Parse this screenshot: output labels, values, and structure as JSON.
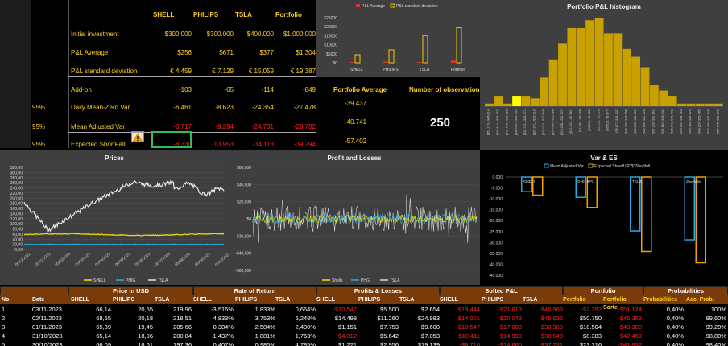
{
  "top_table": {
    "headers": [
      "SHELL",
      "PHILIPS",
      "TSLA",
      "Portfolio"
    ],
    "rows": [
      {
        "label": "Initial investment",
        "values": [
          "$300.000",
          "$300.000",
          "$400.000",
          "$1.000.000"
        ]
      },
      {
        "label": "P&L Average",
        "values": [
          "$256",
          "$671",
          "$377",
          "$1.304"
        ]
      },
      {
        "label": "P&L standard deviation",
        "values": [
          "€ 4.459",
          "€ 7.129",
          "€ 15.059",
          "€ 19.387"
        ]
      },
      {
        "label": "Add-on",
        "values": [
          "-103",
          "-65",
          "-114",
          "-849"
        ]
      },
      {
        "label": "Daily Mean-Zero Var",
        "values": [
          "-6.461",
          "-8.623",
          "-24.354",
          "-27.478"
        ],
        "pct": "95%"
      },
      {
        "label": "Mean Adjusted Var",
        "values": [
          "-6.717",
          "-9.294",
          "-24.731",
          "-28.782"
        ],
        "pct": "95%"
      },
      {
        "label": "Expected ShortFall",
        "values": [
          "-8.330",
          "-13.953",
          "-34.113",
          "-39.294"
        ],
        "pct": "95%"
      }
    ],
    "warning_icon": "warning-icon"
  },
  "portfolio_average": {
    "label": "Portfolio Average",
    "values": [
      "-39.437",
      "-40.741",
      "-57.402"
    ]
  },
  "observations": {
    "label": "Number of observation",
    "value": "250"
  },
  "mini_chart": {
    "legend": [
      "P&L Average",
      "P&L standard deviation"
    ],
    "yticks": [
      "$25000",
      "$20000",
      "$15000",
      "$10000",
      "$5000",
      "$0"
    ],
    "categories": [
      "SHELL",
      "PHILIPS",
      "TSLA",
      "Portfolio"
    ],
    "avg": [
      256,
      671,
      377,
      1304
    ],
    "std": [
      4459,
      7129,
      15059,
      19387
    ],
    "ymax": 25000
  },
  "histogram": {
    "title": "Portfolio P&L histogram",
    "heights": [
      1,
      4,
      1,
      4,
      4,
      3,
      11,
      18,
      24,
      30,
      30,
      33,
      34,
      28,
      28,
      22,
      19,
      15,
      8,
      6,
      4,
      1,
      1,
      1,
      1,
      1
    ],
    "highlight": 3,
    "bins": [
      "[$51.174, -$46.814]",
      "[$46.814, -$42.453]",
      "[$42.453, -$38.092]",
      "[$38.092, -$33.731]",
      "[$33.731, -$29.371]",
      "[$29.371, -$25.010]",
      "[$25.010, -$20.649]",
      "[$20.649, -$16.288]",
      "[$16.288, -$11.927]",
      "[$11.927, -$7.567]",
      "[$7.567, -$3.206]",
      "[$3.206, $1.155]",
      "[$1.155, $5.516]",
      "[$5.516, $9.877]",
      "[$9.877, $14.237]",
      "[$14.237, $18.598]",
      "[$18.598, $22.959]",
      "[$22.959, $27.320]",
      "[$27.320, $31.681]",
      "[$31.681, $36.041]",
      "[$36.041, $40.402]",
      "[$40.402, $44.763]",
      "[$44.763, $49.124]",
      "[$49.124, $53.485]",
      "[$53.485, $57.845]",
      "[$57.845, $62.206]"
    ]
  },
  "prices_chart": {
    "title": "Prices",
    "yticks": [
      "320,00",
      "300,00",
      "280,00",
      "260,00",
      "240,00",
      "220,00",
      "200,00",
      "180,00",
      "160,00",
      "140,00",
      "120,00",
      "100,00",
      "80,00",
      "60,00",
      "40,00",
      "20,00",
      "0,00"
    ],
    "xticks": [
      "05/12/2022",
      "05/01/2023",
      "05/02/2023",
      "05/03/2023",
      "05/04/2023",
      "05/05/2023",
      "05/06/2023",
      "05/07/2023",
      "05/08/2023",
      "05/09/2023",
      "05/10/2023"
    ],
    "legend": [
      "SHELL",
      "PHIG",
      "TSLA"
    ]
  },
  "pl_chart": {
    "title": "Profit and Losses",
    "yticks": [
      "$60,000",
      "$40,000",
      "$20,000",
      "$0",
      "-$20,000",
      "-$40,000",
      "-$60,000"
    ],
    "legend": [
      "Shells",
      "PHG",
      "TSLA"
    ]
  },
  "var_chart": {
    "title": "Var & ES",
    "legend": [
      "Mean Adjusted Var",
      "Expected Sheet1!$D$15hortfall"
    ],
    "yticks": [
      "0.000",
      "-5.000",
      "-10.000",
      "-15.000",
      "-20.000",
      "-25.000",
      "-30.000",
      "-35.000",
      "-40.000",
      "-45.000"
    ],
    "categories": [
      "SHELL",
      "PHILIPS",
      "TSLA",
      "Portfolio"
    ],
    "var": [
      -6717,
      -9294,
      -24731,
      -28782
    ],
    "es": [
      -8330,
      -13953,
      -34113,
      -39294
    ]
  },
  "data_table": {
    "groups": [
      "Price In USD",
      "Rate of Return",
      "Profits & Losses",
      "Softed P&L",
      "Portfolio",
      "Probabilities"
    ],
    "subheaders": [
      "No.",
      "Date",
      "SHELL",
      "PHILIPS",
      "TSLA",
      "SHELL",
      "PHILIPS",
      "TSLA",
      "SHELL",
      "PHILIPS",
      "TSLA",
      "SHELL",
      "PHILIPS",
      "TSLA",
      "Portfolio",
      "Portfolio Sorte",
      "Probabilities",
      "Acc. Prob."
    ],
    "rows": [
      [
        "1",
        "03/11/2023",
        "66,14",
        "20,55",
        "219,96",
        "-3,516%",
        "1,833%",
        "0,664%",
        "-$10.547",
        "$5.500",
        "$2.654",
        "-$19.444",
        "-$21.613",
        "-$48.969",
        "-$2.392",
        "-$51.174",
        "0,40%",
        "100%"
      ],
      [
        "2",
        "02/11/2023",
        "68,55",
        "20,18",
        "218,51",
        "4,833%",
        "3,753%",
        "6,248%",
        "$14.498",
        "$11.260",
        "$24.993",
        "-$14.001",
        "-$20.043",
        "-$45.635",
        "$50.750",
        "-$45.369",
        "0,40%",
        "99,60%"
      ],
      [
        "3",
        "01/11/2023",
        "65,39",
        "19,45",
        "205,66",
        "0,384%",
        "2,584%",
        "2,400%",
        "$1.151",
        "$7.753",
        "$9.600",
        "-$10.547",
        "-$17.803",
        "-$38.983",
        "$18.504",
        "-$43.380",
        "0,40%",
        "99,20%"
      ],
      [
        "4",
        "31/10/2023",
        "65,14",
        "18,96",
        "200,84",
        "-1,437%",
        "1,881%",
        "1,763%",
        "-$4.312",
        "$5.642",
        "$7.053",
        "-$10.411",
        "-$14.990",
        "-$38.948",
        "$8.383",
        "-$42.469",
        "0,40%",
        "98,80%"
      ],
      [
        "5",
        "30/10/2023",
        "66,09",
        "18,61",
        "197,36",
        "0,407%",
        "0,985%",
        "4,785%",
        "$1.221",
        "$2.956",
        "$19.139",
        "-$8.710",
        "-$14.666",
        "-$37.231",
        "$23.316",
        "-$41.932",
        "0,40%",
        "98,40%"
      ]
    ]
  }
}
